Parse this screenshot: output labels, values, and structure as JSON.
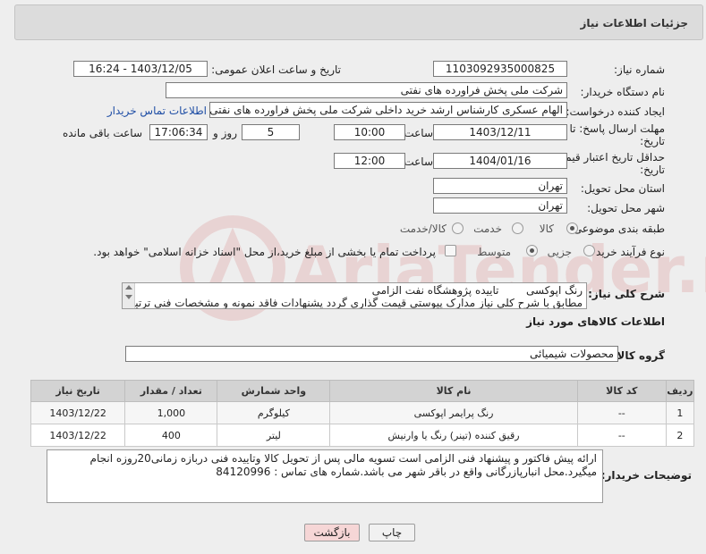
{
  "header": {
    "title": "جزئیات اطلاعات نیاز"
  },
  "need_number": {
    "label": "شماره نیاز:",
    "value": "1103092935000825"
  },
  "announce": {
    "label": "تاریخ و ساعت اعلان عمومی:",
    "value": "1403/12/05 - 16:24"
  },
  "buyer": {
    "label": "نام دستگاه خریدار:",
    "value": "شرکت ملی پخش فراورده های نفتی"
  },
  "creator": {
    "label": "ایجاد کننده درخواست:",
    "value": "الهام عسکری کارشناس ارشد خرید داخلی شرکت ملی پخش فراورده های نفتی",
    "contact_link": "اطلاعات تماس خریدار"
  },
  "deadline": {
    "label_line1": "مهلت ارسال پاسخ: تا",
    "label_line2": "تاریخ:",
    "date": "1403/12/11",
    "time_label": "ساعت",
    "time": "10:00",
    "days": "5",
    "days_label": "روز و",
    "remaining": "17:06:34",
    "remaining_label": "ساعت باقی مانده"
  },
  "validity": {
    "label_line1": "حداقل تاریخ اعتبار قیمت: تا",
    "label_line2": "تاریخ:",
    "date": "1404/01/16",
    "time_label": "ساعت",
    "time": "12:00"
  },
  "province": {
    "label": "استان محل تحویل:",
    "value": "تهران"
  },
  "city": {
    "label": "شهر محل تحویل:",
    "value": "تهران"
  },
  "category": {
    "label": "طبقه بندی موضوعی:",
    "options": [
      "کالا",
      "خدمت",
      "کالا/خدمت"
    ],
    "selected": "کالا"
  },
  "process": {
    "label": "نوع فرآیند خرید :",
    "options": [
      "جزیی",
      "متوسط"
    ],
    "selected": "متوسط",
    "payment_note": "پرداخت تمام یا بخشی از مبلغ خرید،از محل \"اسناد خزانه اسلامی\" خواهد بود."
  },
  "summary": {
    "label": "شرح کلی نیاز:",
    "line1": "رنگ اپوکسی        تاییده پژوهشگاه نفت الزامی",
    "line2": "مطابق با شرح کلی نیاز مدارک پیوستی قیمت گذاری گردد پشنهادات فاقد نمونه و مشخصات فنی ترتیب اثر"
  },
  "goods_section": {
    "title": "اطلاعات کالاهای مورد نیاز"
  },
  "goods_group": {
    "label": "گروه کالا:",
    "value": "محصولات شیمیائی"
  },
  "table": {
    "headers": [
      "ردیف",
      "کد کالا",
      "نام کالا",
      "واحد شمارش",
      "تعداد / مقدار",
      "تاریخ نیاز"
    ],
    "rows": [
      [
        "1",
        "--",
        "رنگ پرایمر اپوکسی",
        "کیلوگرم",
        "1,000",
        "1403/12/22"
      ],
      [
        "2",
        "--",
        "رقیق کننده (تینر) رنگ یا وارنیش",
        "لیتر",
        "400",
        "1403/12/22"
      ]
    ]
  },
  "buyer_notes": {
    "label": "توضیحات خریدار:",
    "line1": "ارائه پیش فاکتور و پیشنهاد فنی الزامی است تسویه مالی پس از تحویل کالا وتاییده فنی دربازه زمانی20روزه انجام",
    "line2": "میگیرد.محل انبارپازرگانی واقع در باقر شهر می باشد.شماره های تماس : 84120996"
  },
  "buttons": {
    "print": "چاپ",
    "back": "بازگشت"
  },
  "watermark": "AriaTender.neT",
  "colors": {
    "link": "#1f4ea5",
    "back_button": "#f6d6d6",
    "watermark": "#c21b1b"
  }
}
